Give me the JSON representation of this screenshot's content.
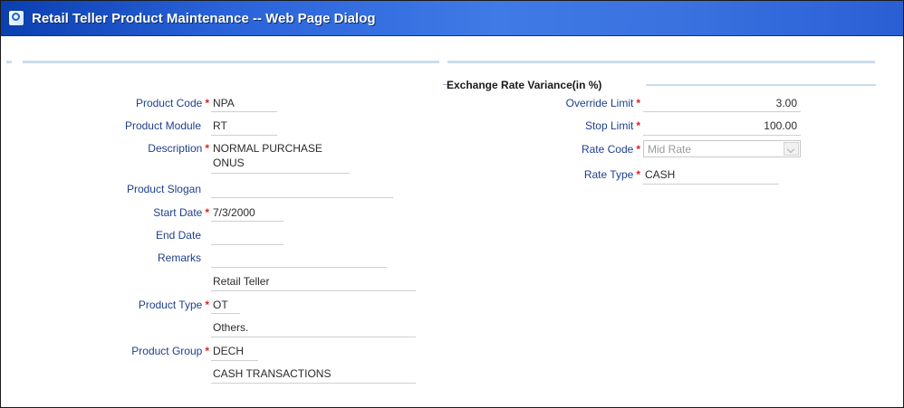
{
  "window": {
    "title": "Retail Teller Product Maintenance -- Web Page Dialog"
  },
  "left": {
    "product_code": {
      "label": "Product Code",
      "value": "NPA"
    },
    "product_module": {
      "label": "Product Module",
      "value": "RT"
    },
    "description": {
      "label": "Description",
      "line1": "NORMAL PURCHASE",
      "line2": "ONUS"
    },
    "product_slogan": {
      "label": "Product Slogan",
      "value": ""
    },
    "start_date": {
      "label": "Start Date",
      "value": "7/3/2000"
    },
    "end_date": {
      "label": "End Date",
      "value": ""
    },
    "remarks": {
      "label": "Remarks",
      "value": "",
      "extra": "Retail Teller"
    },
    "product_type": {
      "label": "Product Type",
      "value": "OT",
      "description": "Others."
    },
    "product_group": {
      "label": "Product Group",
      "value": "DECH",
      "description": "CASH TRANSACTIONS"
    }
  },
  "right": {
    "legend": "Exchange Rate Variance(in %)",
    "override_limit": {
      "label": "Override Limit",
      "value": "3.00"
    },
    "stop_limit": {
      "label": "Stop Limit",
      "value": "100.00"
    },
    "rate_code": {
      "label": "Rate Code",
      "value": "Mid Rate"
    },
    "rate_type": {
      "label": "Rate Type",
      "value": "CASH"
    }
  },
  "required_marker": "*",
  "colors": {
    "title_bar": "#2a63d9",
    "label": "#1f3f8c",
    "required": "#e02020",
    "separator": "#c9dcec"
  }
}
